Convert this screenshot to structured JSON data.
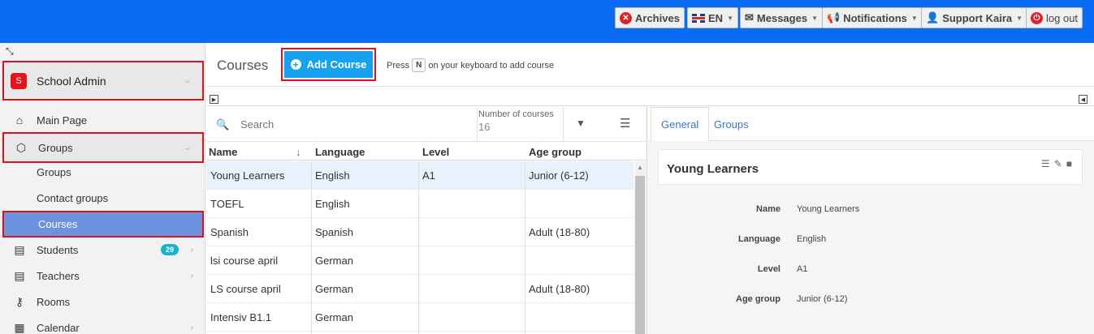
{
  "topbar": {
    "archives": "Archives",
    "language": "EN",
    "messages": "Messages",
    "notifications": "Notifications",
    "user": "Support Kaira",
    "logout": "log out"
  },
  "sidebar": {
    "school": {
      "avatar": "S",
      "name": "School Admin"
    },
    "items": [
      {
        "label": "Main Page"
      },
      {
        "label": "Groups"
      },
      {
        "label": "Groups"
      },
      {
        "label": "Contact groups"
      },
      {
        "label": "Courses"
      },
      {
        "label": "Students",
        "badge": "29"
      },
      {
        "label": "Teachers"
      },
      {
        "label": "Rooms"
      },
      {
        "label": "Calendar"
      }
    ]
  },
  "header": {
    "title": "Courses",
    "add_label": "Add Course",
    "hint_pre": "Press",
    "hint_key": "N",
    "hint_post": "on your keyboard to add course"
  },
  "grid": {
    "search_placeholder": "Search",
    "count_label": "Number of courses",
    "count_value": "16",
    "columns": [
      "Name",
      "Language",
      "Level",
      "Age group"
    ],
    "rows": [
      {
        "name": "Young Learners",
        "language": "English",
        "level": "A1",
        "age": "Junior (6-12)"
      },
      {
        "name": "TOEFL",
        "language": "English",
        "level": "",
        "age": ""
      },
      {
        "name": "Spanish",
        "language": "Spanish",
        "level": "",
        "age": "Adult (18-80)"
      },
      {
        "name": "lsi course april",
        "language": "German",
        "level": "",
        "age": ""
      },
      {
        "name": "LS course april",
        "language": "German",
        "level": "",
        "age": "Adult (18-80)"
      },
      {
        "name": "Intensiv B1.1",
        "language": "German",
        "level": "",
        "age": ""
      }
    ]
  },
  "detail": {
    "tabs": [
      "General",
      "Groups"
    ],
    "title": "Young Learners",
    "fields": [
      {
        "label": "Name",
        "value": "Young Learners"
      },
      {
        "label": "Language",
        "value": "English"
      },
      {
        "label": "Level",
        "value": "A1"
      },
      {
        "label": "Age group",
        "value": "Junior (6-12)"
      }
    ]
  },
  "colors": {
    "topbar": "#0a6cf5",
    "accent": "#16a2ef",
    "highlight": "#e0101f",
    "active_nav": "#6d93e0",
    "badge": "#13b5c9"
  }
}
